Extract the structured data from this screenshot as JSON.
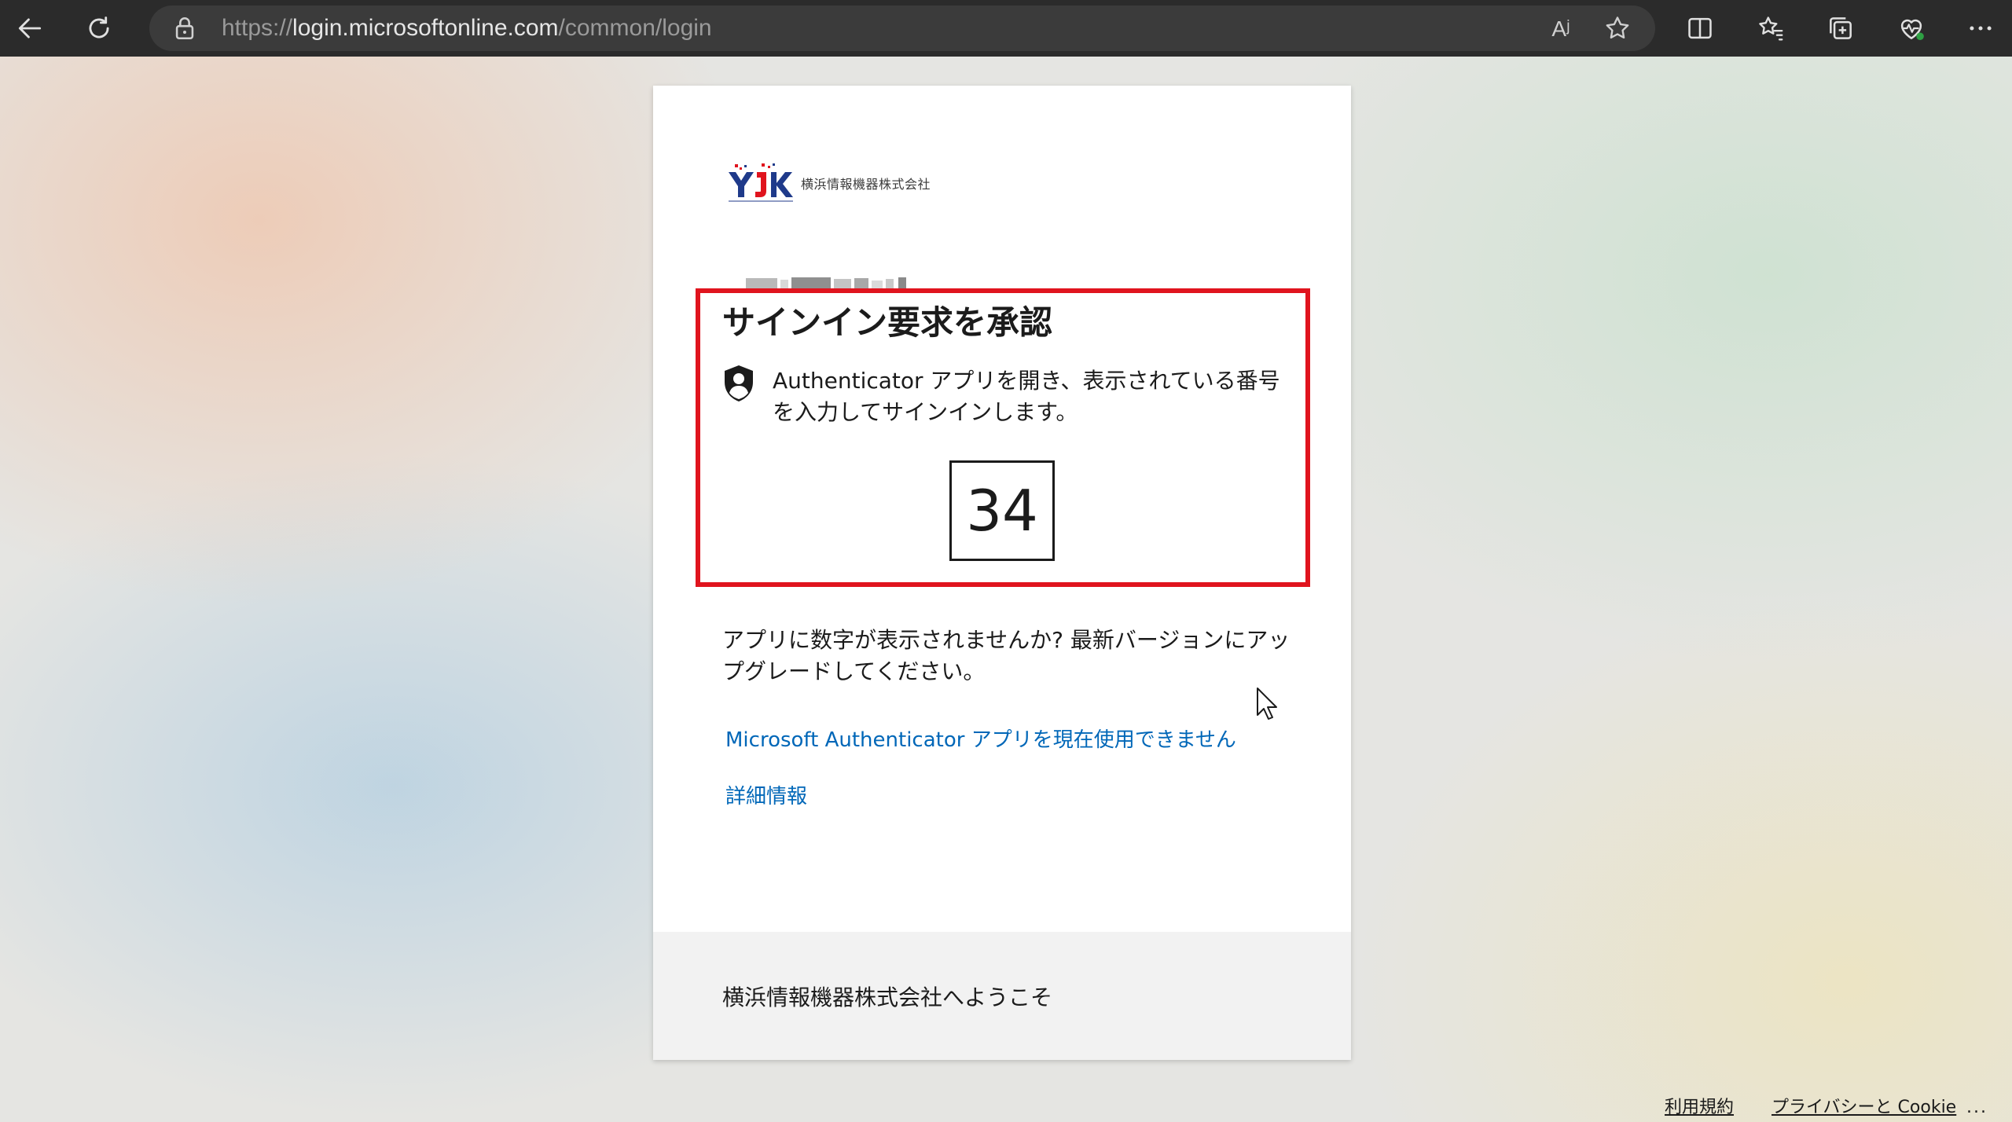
{
  "browser": {
    "url": {
      "scheme": "https://",
      "host": "login.microsoftonline.com",
      "path": "/common/login"
    },
    "read_aloud_glyph": "Aʲ",
    "icons": [
      "back-icon",
      "refresh-icon",
      "lock-icon",
      "read-aloud-icon",
      "favorite-star-icon",
      "split-screen-icon",
      "favorites-icon",
      "collections-icon",
      "browser-essentials-icon",
      "more-icon"
    ]
  },
  "card": {
    "logo_text": "横浜情報機器株式会社",
    "title": "サインイン要求を承認",
    "instruction": "Authenticator アプリを開き、表示されている番号を入力してサインインします。",
    "number": "34",
    "hint": "アプリに数字が表示されませんか? 最新バージョンにアップグレードしてください。",
    "link_cannot_use": "Microsoft Authenticator アプリを現在使用できません",
    "link_more_info": "詳細情報",
    "welcome": "横浜情報機器株式会社へようこそ"
  },
  "footer": {
    "terms": "利用規約",
    "privacy": "プライバシーと Cookie",
    "more": "..."
  },
  "colors": {
    "toolbar_bg": "#2b2b2b",
    "highlight_border": "#e0141e",
    "link": "#0067b8",
    "logo_navy": "#1f3a8a",
    "logo_red": "#e0141e"
  }
}
